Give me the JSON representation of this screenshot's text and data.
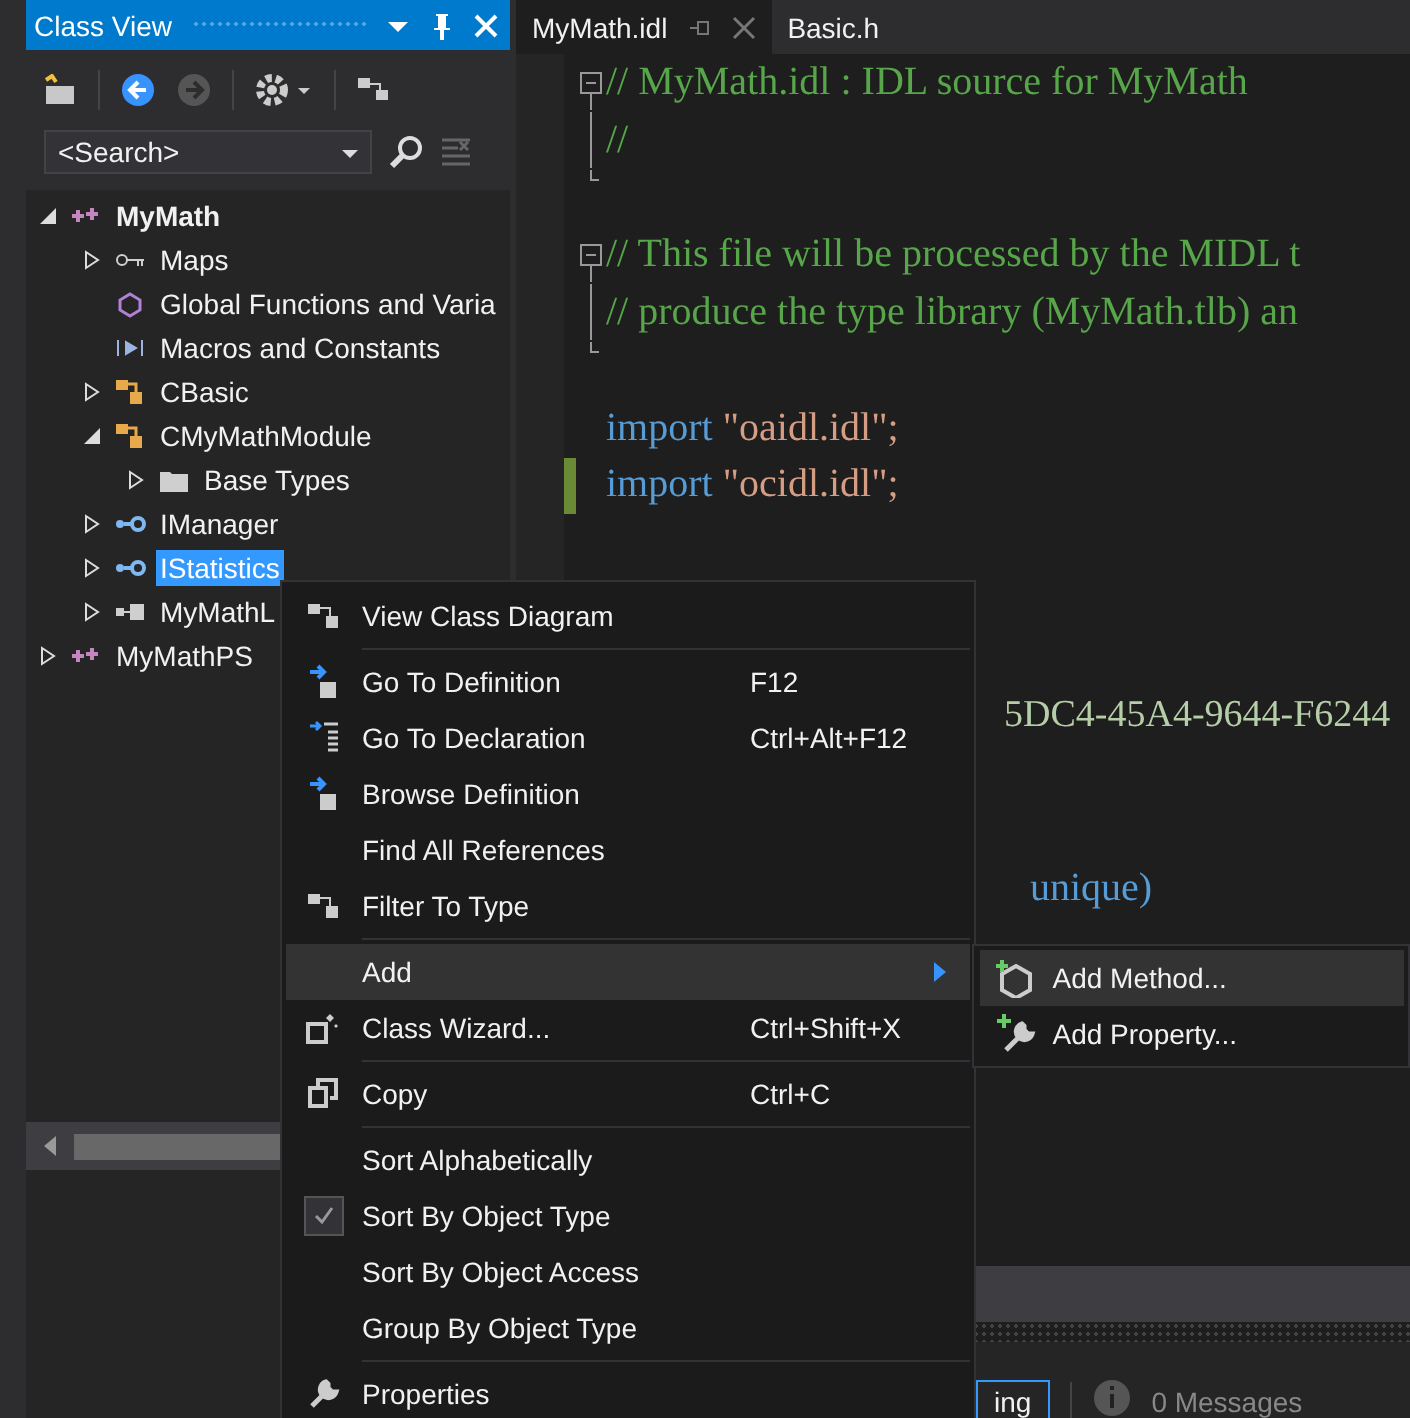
{
  "class_view": {
    "title": "Class View",
    "search": {
      "placeholder": "<Search>"
    },
    "tree": [
      {
        "label": "MyMath",
        "kind": "project",
        "bold": true,
        "expanded": true,
        "selected": false,
        "children": [
          {
            "label": "Maps",
            "kind": "map",
            "expanded": false,
            "selected": false
          },
          {
            "label": "Global Functions and Varia",
            "kind": "global",
            "selected": false
          },
          {
            "label": "Macros and Constants",
            "kind": "macro",
            "selected": false
          },
          {
            "label": "CBasic",
            "kind": "class",
            "expanded": false,
            "selected": false
          },
          {
            "label": "CMyMathModule",
            "kind": "class",
            "expanded": true,
            "selected": false,
            "children": [
              {
                "label": "Base Types",
                "kind": "folder",
                "expanded": false,
                "selected": false
              }
            ]
          },
          {
            "label": "IManager",
            "kind": "interface",
            "expanded": false,
            "selected": false
          },
          {
            "label": "IStatistics",
            "kind": "interface",
            "expanded": false,
            "selected": true
          },
          {
            "label": "MyMathL",
            "kind": "module",
            "expanded": false,
            "selected": false
          }
        ]
      },
      {
        "label": "MyMathPS",
        "kind": "project",
        "bold": false,
        "expanded": false,
        "selected": false
      }
    ]
  },
  "editor": {
    "tabs": [
      {
        "label": "MyMath.idl",
        "selected": true
      },
      {
        "label": "Basic.h",
        "selected": false
      }
    ],
    "lines": [
      {
        "kind": "comment",
        "collapsed": false,
        "text": "// MyMath.idl : IDL source for MyMath"
      },
      {
        "kind": "comment",
        "text": "//"
      },
      {
        "kind": "blank"
      },
      {
        "kind": "comment",
        "collapsed": false,
        "text": "// This file will be processed by the MIDL t"
      },
      {
        "kind": "comment",
        "text": "// produce the type library (MyMath.tlb) an"
      },
      {
        "kind": "blank"
      },
      {
        "kind": "import",
        "changed": false,
        "keyword": "import",
        "text": "\"oaidl.idl\";"
      },
      {
        "kind": "import",
        "changed": true,
        "keyword": "import",
        "text": "\"ocidl.idl\";"
      },
      {
        "kind": "blank"
      },
      {
        "kind": "blank"
      },
      {
        "kind": "blank"
      },
      {
        "kind": "uuid",
        "text": "5DC4-45A4-9644-F6244"
      },
      {
        "kind": "blank"
      },
      {
        "kind": "blank"
      },
      {
        "kind": "attr",
        "text": "unique)"
      }
    ]
  },
  "context_menu": {
    "groups": [
      [
        {
          "label": "View Class Diagram",
          "kind": "diagram",
          "checked": false
        }
      ],
      [
        {
          "label": "Go To Definition",
          "shortcut": "F12",
          "kind": "goto",
          "checked": false
        },
        {
          "label": "Go To Declaration",
          "shortcut": "Ctrl+Alt+F12",
          "kind": "declaration",
          "checked": false
        },
        {
          "label": "Browse Definition",
          "kind": "goto",
          "checked": false
        },
        {
          "label": "Find All References",
          "checked": false
        },
        {
          "label": "Filter To Type",
          "kind": "diagram",
          "checked": false
        }
      ],
      [
        {
          "label": "Add",
          "submenu": true,
          "selected": true,
          "checked": false
        },
        {
          "label": "Class Wizard...",
          "shortcut": "Ctrl+Shift+X",
          "kind": "wizard",
          "checked": false
        }
      ],
      [
        {
          "label": "Copy",
          "shortcut": "Ctrl+C",
          "kind": "copy",
          "checked": false
        }
      ],
      [
        {
          "label": "Sort Alphabetically",
          "checked": false
        },
        {
          "label": "Sort By Object Type",
          "checked": true
        },
        {
          "label": "Sort By Object Access",
          "checked": false
        },
        {
          "label": "Group By Object Type",
          "checked": false
        }
      ],
      [
        {
          "label": "Properties",
          "kind": "wrench",
          "checked": false
        }
      ]
    ],
    "submenu": [
      {
        "label": "Add Method...",
        "kind": "method",
        "selected": true
      },
      {
        "label": "Add Property...",
        "kind": "property",
        "selected": false
      }
    ]
  },
  "output_panel": {
    "tabs": [
      {
        "label": "ing",
        "selected": true
      }
    ],
    "messages": "0 Messages"
  }
}
